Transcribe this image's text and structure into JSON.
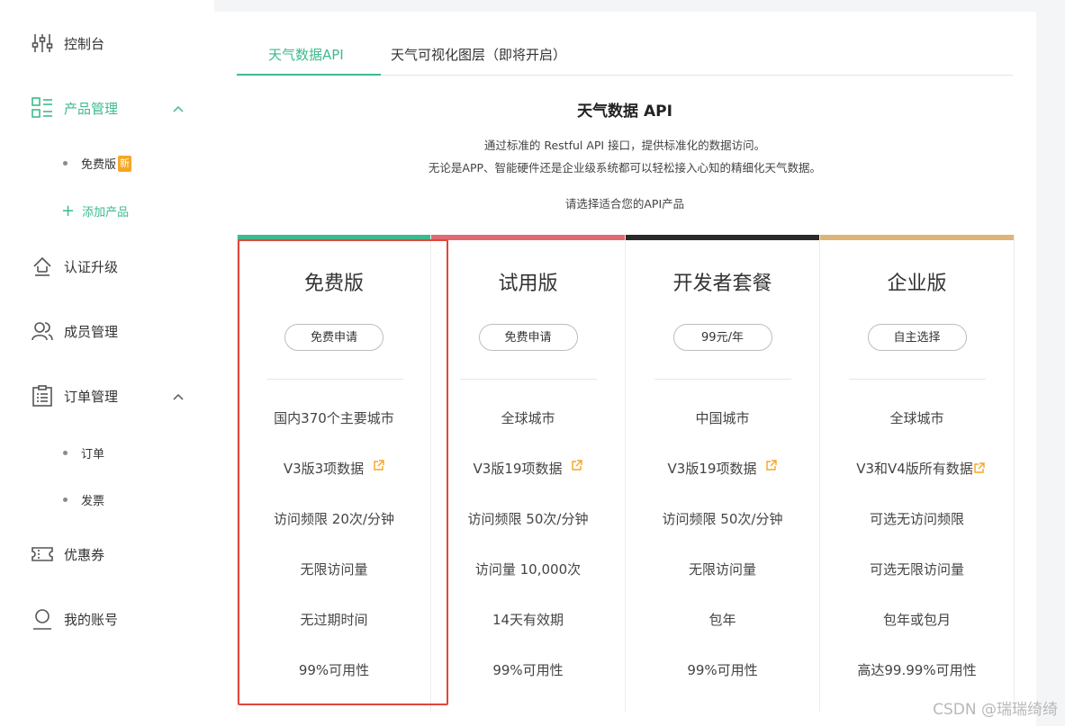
{
  "sidebar": {
    "items": [
      {
        "label": "控制台",
        "icon": "sliders-icon"
      },
      {
        "label": "产品管理",
        "icon": "grid-list-icon",
        "active": true,
        "subitems": [
          {
            "label": "免费版",
            "badge": "新"
          },
          {
            "label": "添加产品",
            "is_add": true
          }
        ]
      },
      {
        "label": "认证升级",
        "icon": "upgrade-icon"
      },
      {
        "label": "成员管理",
        "icon": "members-icon"
      },
      {
        "label": "订单管理",
        "icon": "clipboard-icon",
        "subitems": [
          {
            "label": "订单"
          },
          {
            "label": "发票"
          }
        ]
      },
      {
        "label": "优惠券",
        "icon": "ticket-icon"
      },
      {
        "label": "我的账号",
        "icon": "user-icon"
      }
    ]
  },
  "tabs": [
    {
      "label": "天气数据API",
      "active": true
    },
    {
      "label": "天气可视化图层（即将开启）",
      "active": false
    }
  ],
  "main": {
    "title": "天气数据 API",
    "desc1": "通过标准的 Restful API 接口，提供标准化的数据访问。",
    "desc2": "无论是APP、智能硬件还是企业级系统都可以轻松接入心知的精细化天气数据。",
    "prompt": "请选择适合您的API产品"
  },
  "plans": [
    {
      "name": "免费版",
      "button": "免费申请",
      "color": "#3dba8c",
      "features": [
        "国内370个主要城市",
        "V3版3项数据",
        "访问频限 20次/分钟",
        "无限访问量",
        "无过期时间",
        "99%可用性"
      ]
    },
    {
      "name": "试用版",
      "button": "免费申请",
      "color": "#e06a72",
      "features": [
        "全球城市",
        "V3版19项数据",
        "访问频限 50次/分钟",
        "访问量 10,000次",
        "14天有效期",
        "99%可用性"
      ]
    },
    {
      "name": "开发者套餐",
      "button": "99元/年",
      "color": "#2a2a2a",
      "features": [
        "中国城市",
        "V3版19项数据",
        "访问频限 50次/分钟",
        "无限访问量",
        "包年",
        "99%可用性"
      ]
    },
    {
      "name": "企业版",
      "button": "自主选择",
      "color": "#deb577",
      "features": [
        "全球城市",
        "V3和V4版所有数据",
        "可选无访问频限",
        "可选无限访问量",
        "包年或包月",
        "高达99.99%可用性"
      ]
    }
  ],
  "colors": {
    "accent": "#3dba8c",
    "external_link": "#f5a623",
    "highlight": "#e0463c"
  },
  "watermark": "CSDN @瑞瑞绮绮"
}
